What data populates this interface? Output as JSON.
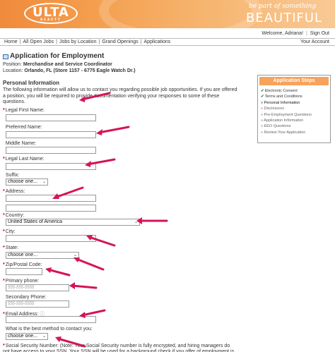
{
  "banner": {
    "logo": "ULTA",
    "logo_sub": "BEAUTY",
    "tagline_small": "be part of something",
    "tagline_big": "BEAUTIFUL"
  },
  "header": {
    "welcome": "Welcome, Adriana!",
    "sign_out": "Sign Out",
    "your_account": "Your Account"
  },
  "nav": {
    "items": [
      "Home",
      "All Open Jobs",
      "Jobs by Location",
      "Grand Openings",
      "Applications"
    ]
  },
  "application": {
    "title": "Application for Employment",
    "position_label": "Position:",
    "position_value": "Merchandise and Service Coordinator",
    "location_label": "Location:",
    "location_value": "Orlando, FL  (Store 1157 - 6775 Eagle Watch Dr.)"
  },
  "personal": {
    "heading": "Personal Information",
    "intro": "The following information will allow us to contact you regarding possible job opportunities. If you are offered a position, you will be required to provide documentation verifying your responses to some of these questions."
  },
  "fields": {
    "first_name": "Legal First Name:",
    "preferred_name": "Preferred Name:",
    "middle_name": "Middle Name:",
    "last_name": "Legal Last Name:",
    "suffix": "Suffix:",
    "suffix_value": "choose one...",
    "address": "Address:",
    "country": "Country:",
    "country_value": "United States of America",
    "city": "City:",
    "state": "State:",
    "state_value": "choose one...",
    "zip": "Zip/Postal Code:",
    "primary_phone": "Primary phone:",
    "primary_phone_placeholder": "555-555-5555",
    "secondary_phone": "Secondary Phone:",
    "secondary_phone_placeholder": "555-555-5555",
    "email": "Email Address:",
    "contact_method": "What is the best method to contact you:",
    "contact_method_value": "choose one...",
    "ssn_note": "Social Security Number: (Note: Your Social Security number is fully encrypted, and hiring managers do not have access to your SSN. Your SSN will be used for a background check if you offer of employment is"
  },
  "steps": {
    "title": "Application Steps",
    "items": [
      {
        "label": "Electronic Consent",
        "done": true
      },
      {
        "label": "Terms and Conditions",
        "done": true
      },
      {
        "label": "Personal Information",
        "done": false
      },
      {
        "label": "Disclosures",
        "done": false
      },
      {
        "label": "Pre-Employment Questions",
        "done": false
      },
      {
        "label": "Application Information",
        "done": false
      },
      {
        "label": "EEO Questions",
        "done": false
      },
      {
        "label": "Review Your Application",
        "done": false
      }
    ]
  },
  "colors": {
    "banner_orange": "#f08a3c",
    "required_red": "#d0021b",
    "arrow_red": "#d4145a",
    "steps_header": "#f5a35d",
    "check_green": "#2a8a2a"
  }
}
